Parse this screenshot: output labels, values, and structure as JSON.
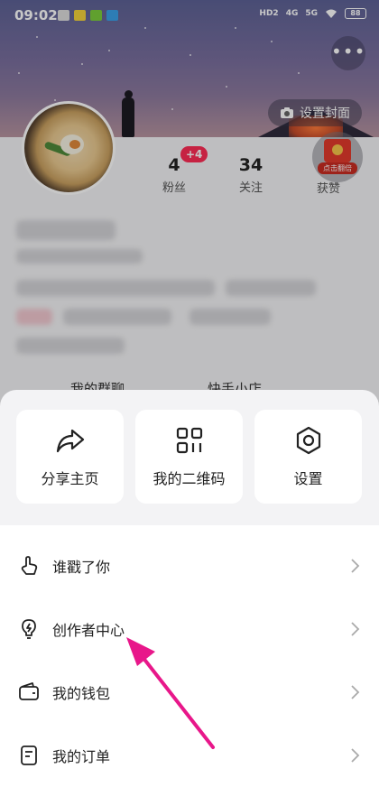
{
  "status_bar": {
    "time": "09:02",
    "network": [
      "HD2",
      "4G",
      "5G"
    ],
    "battery": "88"
  },
  "cover": {
    "more_label": "•••",
    "set_cover_label": "设置封面"
  },
  "profile": {
    "stats": [
      {
        "value": "4",
        "label": "粉丝",
        "badge": "+4"
      },
      {
        "value": "34",
        "label": "关注"
      },
      {
        "label": "获赞"
      }
    ],
    "red_packet_label": "点击翻倍",
    "behind_items": [
      "我的群聊",
      "快手小店"
    ]
  },
  "sheet": {
    "quick_actions": [
      {
        "label": "分享主页",
        "icon": "share-icon"
      },
      {
        "label": "我的二维码",
        "icon": "qr-code-icon"
      },
      {
        "label": "设置",
        "icon": "settings-icon"
      }
    ],
    "menu_items": [
      {
        "label": "谁戳了你",
        "icon": "poke-hand-icon"
      },
      {
        "label": "创作者中心",
        "icon": "creator-bulb-icon"
      },
      {
        "label": "我的钱包",
        "icon": "wallet-icon"
      },
      {
        "label": "我的订单",
        "icon": "order-icon"
      }
    ]
  },
  "colors": {
    "accent": "#fe2c55",
    "annotation_arrow": "#e8178a"
  }
}
